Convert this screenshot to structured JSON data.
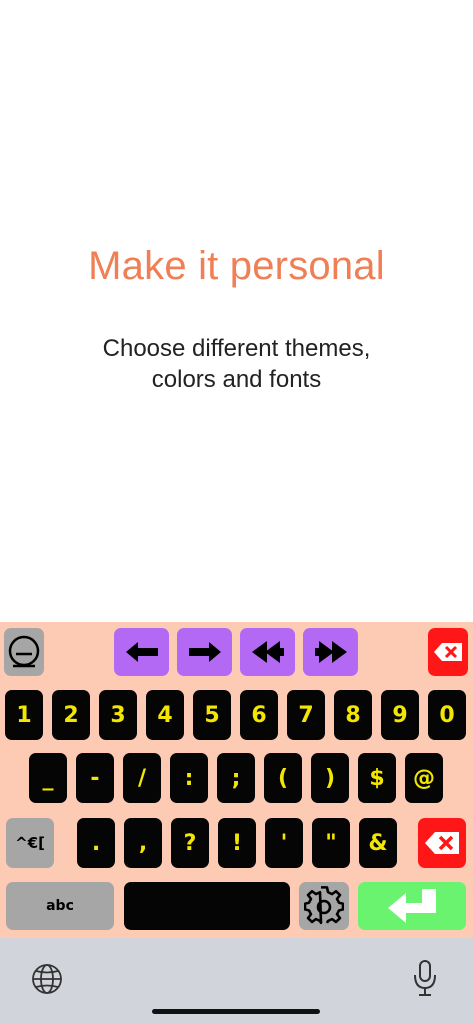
{
  "onboarding": {
    "title": "Make it personal",
    "subtitle_line1": "Choose different themes,",
    "subtitle_line2": "colors and fonts"
  },
  "keyboard": {
    "theme_colors": {
      "background": "#fdcab4",
      "key": "#050505",
      "key_text": "#f3e600",
      "nav": "#b469f5",
      "delete": "#ff1717",
      "enter": "#69f36f",
      "function": "#a6a6a6"
    },
    "toolbar": {
      "emoji_icon": "emoji-face-icon",
      "left_icon": "arrow-left-icon",
      "right_icon": "arrow-right-icon",
      "word_left_icon": "double-arrow-left-icon",
      "word_right_icon": "double-arrow-right-icon",
      "dismiss_icon": "delete-x-icon"
    },
    "number_row": [
      "1",
      "2",
      "3",
      "4",
      "5",
      "6",
      "7",
      "8",
      "9",
      "0"
    ],
    "symbol_row": [
      "_",
      "-",
      "/",
      ":",
      ";",
      "(",
      ")",
      "$",
      "@"
    ],
    "punct_row": [
      ".",
      ",",
      "?",
      "!",
      "'",
      "\"",
      "&"
    ],
    "more_symbols_label": "^€[",
    "abc_label": "abc",
    "space_label": "",
    "settings_icon": "gear-icon",
    "enter_icon": "return-arrow-icon",
    "backspace_icon": "backspace-icon"
  },
  "system_bar": {
    "globe_icon": "globe-icon",
    "mic_icon": "microphone-icon"
  }
}
